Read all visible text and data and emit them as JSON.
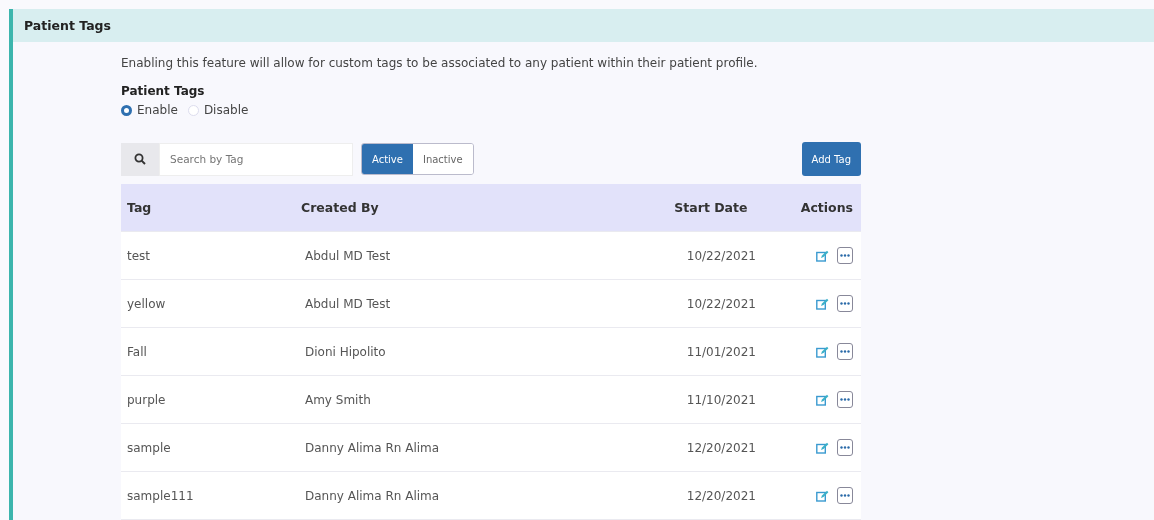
{
  "section": {
    "title": "Patient Tags"
  },
  "description": "Enabling this feature will allow for custom tags to be associated to any patient within their patient profile.",
  "setting": {
    "label": "Patient Tags",
    "options": [
      {
        "label": "Enable",
        "selected": true
      },
      {
        "label": "Disable",
        "selected": false
      }
    ]
  },
  "search": {
    "placeholder": "Search by Tag"
  },
  "filter": [
    {
      "label": "Active",
      "selected": true
    },
    {
      "label": "Inactive",
      "selected": false
    }
  ],
  "add_button": "Add Tag",
  "table": {
    "columns": [
      "Tag",
      "Created By",
      "Start Date",
      "Actions"
    ],
    "rows": [
      {
        "tag": "test",
        "created_by": "Abdul MD Test",
        "start_date": "10/22/2021"
      },
      {
        "tag": "yellow",
        "created_by": "Abdul MD Test",
        "start_date": "10/22/2021"
      },
      {
        "tag": "Fall",
        "created_by": "Dioni Hipolito",
        "start_date": "11/01/2021"
      },
      {
        "tag": "purple",
        "created_by": "Amy Smith",
        "start_date": "11/10/2021"
      },
      {
        "tag": "sample",
        "created_by": "Danny Alima Rn Alima",
        "start_date": "12/20/2021"
      },
      {
        "tag": "sample111",
        "created_by": "Danny Alima Rn Alima",
        "start_date": "12/20/2021"
      }
    ]
  }
}
